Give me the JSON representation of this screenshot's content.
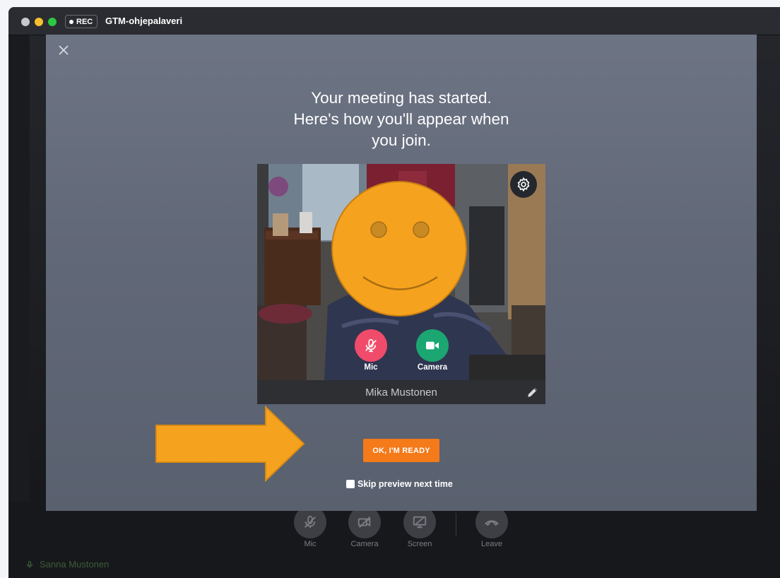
{
  "window": {
    "title": "GTM-ohjepalaveri",
    "rec_label": "REC"
  },
  "modal": {
    "headline_line1": "Your meeting has started.",
    "headline_line2": "Here's how you'll appear when",
    "headline_line3": "you join.",
    "preview": {
      "mic_label": "Mic",
      "camera_label": "Camera",
      "display_name": "Mika Mustonen"
    },
    "ready_button": "OK, I'M READY",
    "skip_label": "Skip preview next time"
  },
  "toolbar": {
    "mic_label": "Mic",
    "camera_label": "Camera",
    "screen_label": "Screen",
    "leave_label": "Leave"
  },
  "speaker_name": "Sanna Mustonen",
  "colors": {
    "accent_orange": "#f47a1a",
    "mic_button": "#f04b6a",
    "camera_button": "#1ba672",
    "annotation_arrow": "#f5a21f"
  }
}
